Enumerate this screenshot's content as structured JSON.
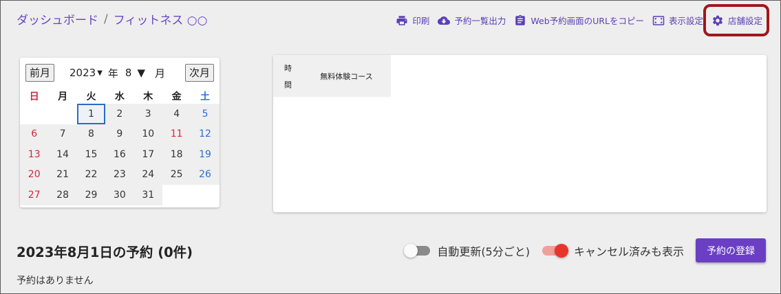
{
  "breadcrumb": {
    "home": "ダッシュボード",
    "separator": "/",
    "current": "フィットネス ○○"
  },
  "toolbar": {
    "print": "印刷",
    "export": "予約一覧出力",
    "copy_url": "Web予約画面のURLをコピー",
    "display_settings": "表示設定",
    "store_settings": "店舗設定"
  },
  "calendar": {
    "prev": "前月",
    "next": "次月",
    "year": "2023",
    "year_unit": "年",
    "month": "8",
    "month_unit": "月",
    "weekdays": [
      "日",
      "月",
      "火",
      "水",
      "木",
      "金",
      "土"
    ],
    "selected_day": "1",
    "weeks": [
      [
        "",
        "",
        "1",
        "2",
        "3",
        "4",
        "5"
      ],
      [
        "6",
        "7",
        "8",
        "9",
        "10",
        "11",
        "12"
      ],
      [
        "13",
        "14",
        "15",
        "16",
        "17",
        "18",
        "19"
      ],
      [
        "20",
        "21",
        "22",
        "23",
        "24",
        "25",
        "26"
      ],
      [
        "27",
        "28",
        "29",
        "30",
        "31",
        "",
        ""
      ]
    ],
    "holidays": [
      "11"
    ]
  },
  "schedule": {
    "time_header_1": "時",
    "time_header_2": "間",
    "course": "無料体験コース"
  },
  "reservations": {
    "title": "2023年8月1日の予約 (0件)",
    "empty": "予約はありません",
    "auto_refresh": "自動更新(5分ごと)",
    "auto_refresh_on": false,
    "show_cancelled": "キャンセル済みも表示",
    "show_cancelled_on": true,
    "register": "予約の登録"
  },
  "colors": {
    "accent": "#6a3fc4",
    "highlight": "#a1161b",
    "sunday": "#d6263d",
    "saturday": "#2a6fd6"
  }
}
